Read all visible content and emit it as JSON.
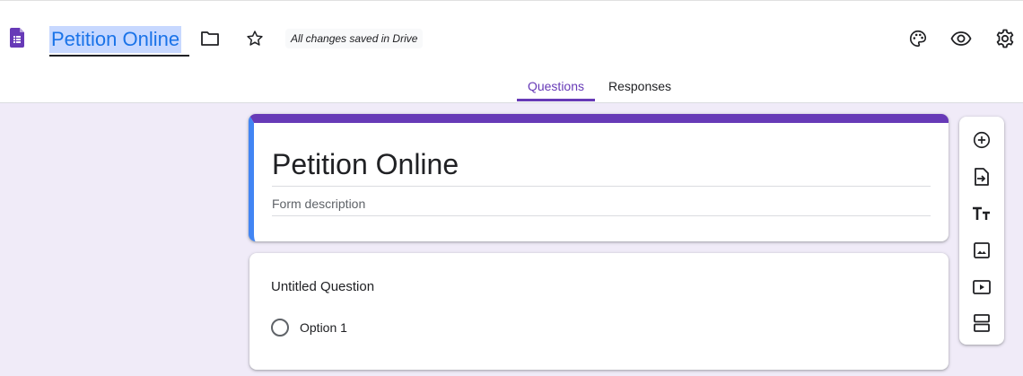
{
  "header": {
    "form_name": "Petition Online",
    "save_status": "All changes saved in Drive",
    "icons": [
      "forms-logo-icon",
      "folder-icon",
      "star-icon",
      "palette-icon",
      "preview-eye-icon",
      "settings-gear-icon"
    ]
  },
  "tabs": [
    {
      "label": "Questions",
      "active": true
    },
    {
      "label": "Responses",
      "active": false
    }
  ],
  "form": {
    "title": "Petition Online",
    "description_placeholder": "Form description"
  },
  "question": {
    "title": "Untitled Question",
    "options": [
      "Option 1"
    ]
  },
  "toolbar": {
    "tools": [
      "add-question-icon",
      "import-questions-icon",
      "add-title-icon",
      "add-image-icon",
      "add-video-icon",
      "add-section-icon"
    ]
  },
  "colors": {
    "accent": "#673ab7",
    "active_bar": "#4285f4",
    "background": "#f0ebf8",
    "selection": "#c7d8ff"
  }
}
